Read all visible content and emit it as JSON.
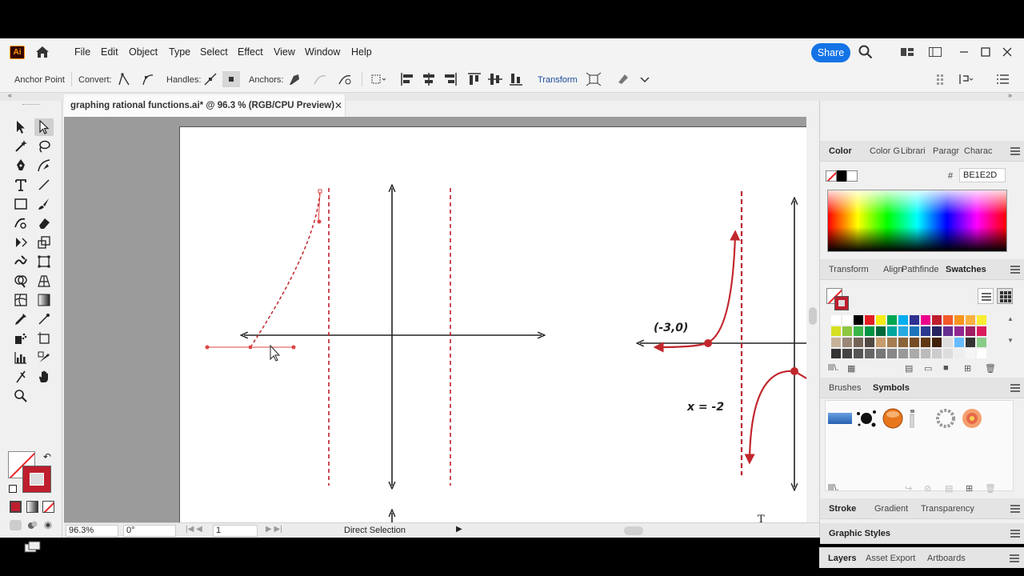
{
  "app": {
    "logo": "Ai",
    "menu": [
      "File",
      "Edit",
      "Object",
      "Type",
      "Select",
      "Effect",
      "View",
      "Window",
      "Help"
    ],
    "share_label": "Share"
  },
  "controlbar": {
    "anchor_point": "Anchor Point",
    "convert": "Convert:",
    "handles": "Handles:",
    "anchors": "Anchors:",
    "transform": "Transform"
  },
  "document": {
    "title": "graphing rational functions.ai* @ 96.3 % (RGB/CPU Preview)",
    "close": "✕"
  },
  "canvas": {
    "point_label": "(-3,0)",
    "asymptote_label": "x = -2",
    "cursor_glyph": "T"
  },
  "status": {
    "zoom": "96.3%",
    "rotation": "0°",
    "artboard": "1",
    "tool": "Direct Selection"
  },
  "panels": {
    "color_tabs": [
      "Color",
      "Color G",
      "Librari",
      "Paragr",
      "Charac"
    ],
    "hex_label": "#",
    "hex_value": "BE1E2D",
    "swatch_tabs": [
      "Transform",
      "Align",
      "Pathfinde",
      "Swatches"
    ],
    "symbol_tabs": [
      "Brushes",
      "Symbols"
    ],
    "stroke_tabs": [
      "Stroke",
      "Gradient",
      "Transparency"
    ],
    "graphic_styles": "Graphic Styles",
    "layer_tabs": [
      "Layers",
      "Asset Export",
      "Artboards"
    ]
  },
  "colors": {
    "accent": "#1473e6",
    "fill": "#be1e2d",
    "curve": "#c1272d"
  }
}
